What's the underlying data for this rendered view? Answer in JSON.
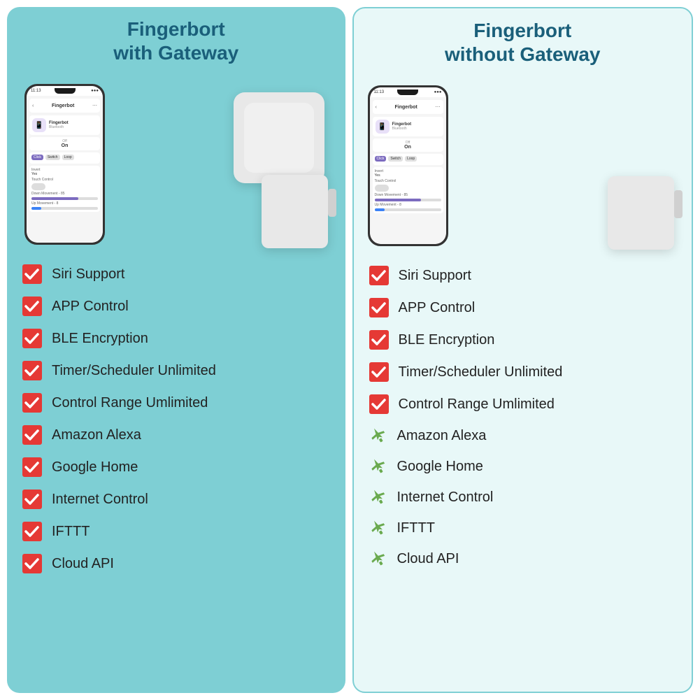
{
  "columns": [
    {
      "id": "with-gateway",
      "title_line1": "Fingerbort",
      "title_line2": "with Gateway",
      "features": [
        {
          "id": "siri",
          "label": "Siri Support",
          "available": true
        },
        {
          "id": "app",
          "label": "APP Control",
          "available": true
        },
        {
          "id": "ble",
          "label": "BLE Encryption",
          "available": true
        },
        {
          "id": "timer",
          "label": "Timer/Scheduler Unlimited",
          "available": true
        },
        {
          "id": "control-range",
          "label": "Control Range Umlimited",
          "available": true
        },
        {
          "id": "alexa",
          "label": "Amazon Alexa",
          "available": true
        },
        {
          "id": "google",
          "label": "Google Home",
          "available": true
        },
        {
          "id": "internet",
          "label": "Internet Control",
          "available": true
        },
        {
          "id": "ifttt",
          "label": "IFTTT",
          "available": true
        },
        {
          "id": "cloud",
          "label": "Cloud API",
          "available": true
        }
      ]
    },
    {
      "id": "without-gateway",
      "title_line1": "Fingerbort",
      "title_line2": "without Gateway",
      "features": [
        {
          "id": "siri",
          "label": "Siri Support",
          "available": true
        },
        {
          "id": "app",
          "label": "APP Control",
          "available": true
        },
        {
          "id": "ble",
          "label": "BLE Encryption",
          "available": true
        },
        {
          "id": "timer",
          "label": "Timer/Scheduler Unlimited",
          "available": true
        },
        {
          "id": "control-range",
          "label": "Control Range Umlimited",
          "available": true
        },
        {
          "id": "alexa",
          "label": "Amazon Alexa",
          "available": false
        },
        {
          "id": "google",
          "label": "Google Home",
          "available": false
        },
        {
          "id": "internet",
          "label": "Internet Control",
          "available": false
        },
        {
          "id": "ifttt",
          "label": "IFTTT",
          "available": false
        },
        {
          "id": "cloud",
          "label": "Cloud API",
          "available": false
        }
      ]
    }
  ]
}
